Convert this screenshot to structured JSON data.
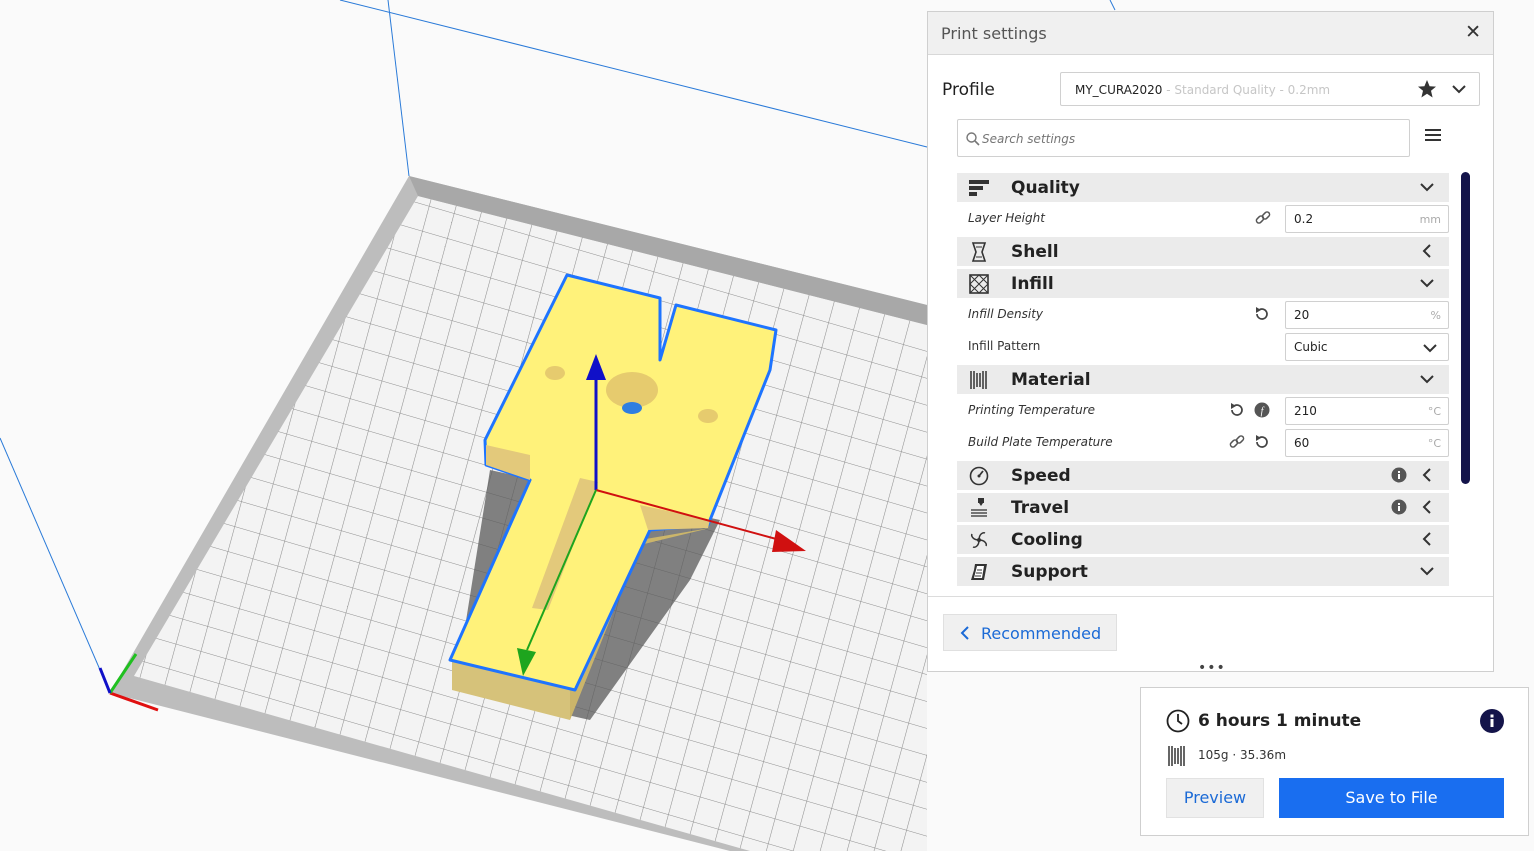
{
  "print_settings": {
    "title": "Print settings",
    "close_icon": "close-icon",
    "profile": {
      "label": "Profile",
      "name": "MY_CURA2020",
      "quality": " - Standard Quality - 0.2mm"
    },
    "search": {
      "placeholder": "Search settings"
    },
    "categories": {
      "quality": "Quality",
      "shell": "Shell",
      "infill": "Infill",
      "material": "Material",
      "speed": "Speed",
      "travel": "Travel",
      "cooling": "Cooling",
      "support": "Support"
    },
    "settings": {
      "layer_height": {
        "label": "Layer Height",
        "value": "0.2",
        "unit": "mm"
      },
      "infill_density": {
        "label": "Infill Density",
        "value": "20",
        "unit": "%"
      },
      "infill_pattern": {
        "label": "Infill Pattern",
        "value": "Cubic"
      },
      "printing_temperature": {
        "label": "Printing Temperature",
        "value": "210",
        "unit": "°C"
      },
      "build_plate_temperature": {
        "label": "Build Plate Temperature",
        "value": "60",
        "unit": "°C"
      }
    },
    "recommended_label": "Recommended"
  },
  "action_panel": {
    "print_time": "6 hours 1 minute",
    "material_usage": "105g · 35.36m",
    "preview_label": "Preview",
    "save_label": "Save to File"
  },
  "colors": {
    "accent": "#196ef0",
    "model": "#fff27a",
    "selection_outline": "#1e74ff",
    "axis_x": "#d01010",
    "axis_y": "#1ea51e",
    "axis_z": "#1010c8",
    "scrollbar": "#14144a"
  }
}
